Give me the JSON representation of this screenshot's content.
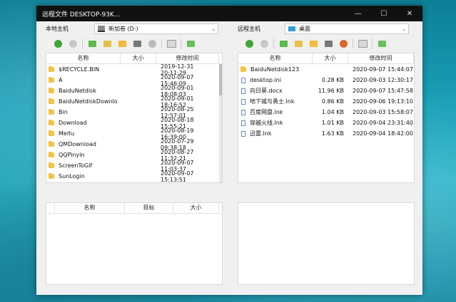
{
  "window": {
    "title": "远程文件 DESKTOP-93K...",
    "minimize": "—",
    "maximize": "☐",
    "close": "✕"
  },
  "local": {
    "label": "本地主机",
    "drive": "新加卷 (D:)",
    "columns": [
      "名称",
      "大小",
      "修改时间"
    ],
    "rows": [
      {
        "name": "$RECYCLE.BIN",
        "size": "",
        "date": "2019-12-31 20:11:29",
        "type": "folder"
      },
      {
        "name": "A",
        "size": "",
        "date": "2020-09-07 15:46:09",
        "type": "folder"
      },
      {
        "name": "BaiduNetdisk",
        "size": "",
        "date": "2020-09-01 18:08:03",
        "type": "folder"
      },
      {
        "name": "BaiduNetdiskDownlo",
        "size": "",
        "date": "2020-09-01 18:16:52",
        "type": "folder"
      },
      {
        "name": "Bin",
        "size": "",
        "date": "2020-08-25 12:57:01",
        "type": "folder"
      },
      {
        "name": "Download",
        "size": "",
        "date": "2020-08-18 15:55:21",
        "type": "folder"
      },
      {
        "name": "Meitu",
        "size": "",
        "date": "2020-08-19 16:39:00",
        "type": "folder"
      },
      {
        "name": "QMDownload",
        "size": "",
        "date": "2020-07-29 09:38:18",
        "type": "folder"
      },
      {
        "name": "QQPinyin",
        "size": "",
        "date": "2020-08-27 11:32:21",
        "type": "folder"
      },
      {
        "name": "ScreenToGif",
        "size": "",
        "date": "2020-09-07 11:03:37",
        "type": "folder"
      },
      {
        "name": "SunLogin",
        "size": "",
        "date": "2020-09-07 15:13:51",
        "type": "folder"
      }
    ]
  },
  "remote": {
    "label": "远程主机",
    "drive": "桌面",
    "columns": [
      "名称",
      "大小",
      "修改时间"
    ],
    "rows": [
      {
        "name": "BaiduNetdisk123",
        "size": "",
        "date": "2020-09-07 15:44:07",
        "type": "folder"
      },
      {
        "name": "desktop.ini",
        "size": "0.28 KB",
        "date": "2020-09-03 12:30:17",
        "type": "file"
      },
      {
        "name": "向日葵.docx",
        "size": "11.96 KB",
        "date": "2020-09-07 15:47:58",
        "type": "file"
      },
      {
        "name": "地下城与勇士.lnk",
        "size": "0.86 KB",
        "date": "2020-09-06 19:13:10",
        "type": "file"
      },
      {
        "name": "百度网盘.lnk",
        "size": "1.04 KB",
        "date": "2020-09-03 15:58:07",
        "type": "file"
      },
      {
        "name": "穿越火线.lnk",
        "size": "1.01 KB",
        "date": "2020-09-04 23:31:40",
        "type": "file"
      },
      {
        "name": "迅雷.lnk",
        "size": "1.63 KB",
        "date": "2020-09-04 18:42:00",
        "type": "file"
      }
    ]
  },
  "transfer": {
    "columns": [
      "名称",
      "目标",
      "大小"
    ]
  },
  "colors": {
    "accent": "#2e9ed8",
    "folder": "#f5c242",
    "refresh": "#3fa535"
  }
}
